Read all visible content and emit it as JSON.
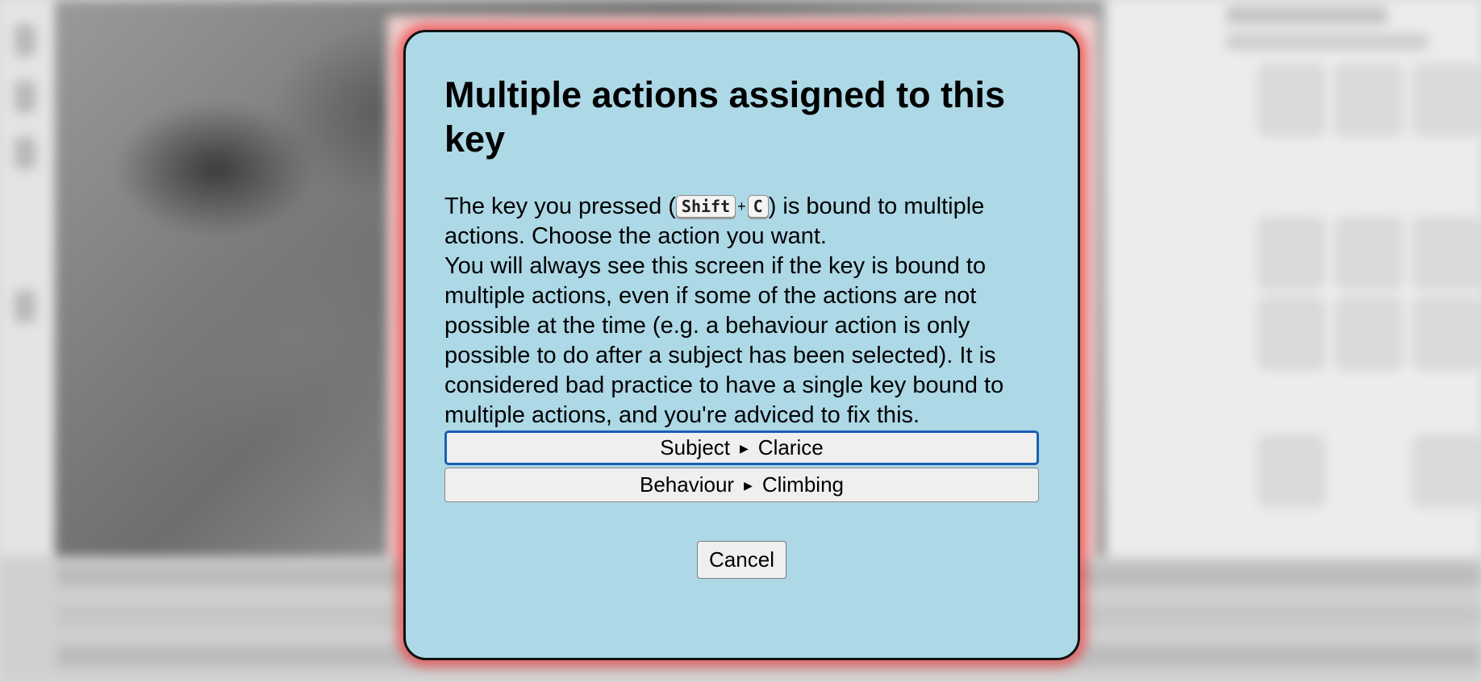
{
  "dialog": {
    "title": "Multiple actions assigned to this key",
    "body_prefix": "The key you pressed (",
    "key_modifier": "Shift",
    "key_plus": "+",
    "key_char": "C",
    "body_suffix": ") is bound to multiple actions. Choose the action you want.",
    "body_note": "You will always see this screen if the key is bound to multiple actions, even if some of the actions are not possible at the time (e.g. a behaviour action is only possible to do after a subject has been selected). It is considered bad practice to have a single key bound to multiple actions, and you're adviced to fix this.",
    "actions": [
      {
        "category": "Subject",
        "name": "Clarice",
        "focused": true
      },
      {
        "category": "Behaviour",
        "name": "Climbing",
        "focused": false
      }
    ],
    "cancel_label": "Cancel"
  },
  "colors": {
    "dialog_background": "#add8e6",
    "dialog_glow": "#eb4646",
    "focus_ring": "#1a5fb4"
  },
  "icons": {
    "separator": "caret-right-icon"
  }
}
